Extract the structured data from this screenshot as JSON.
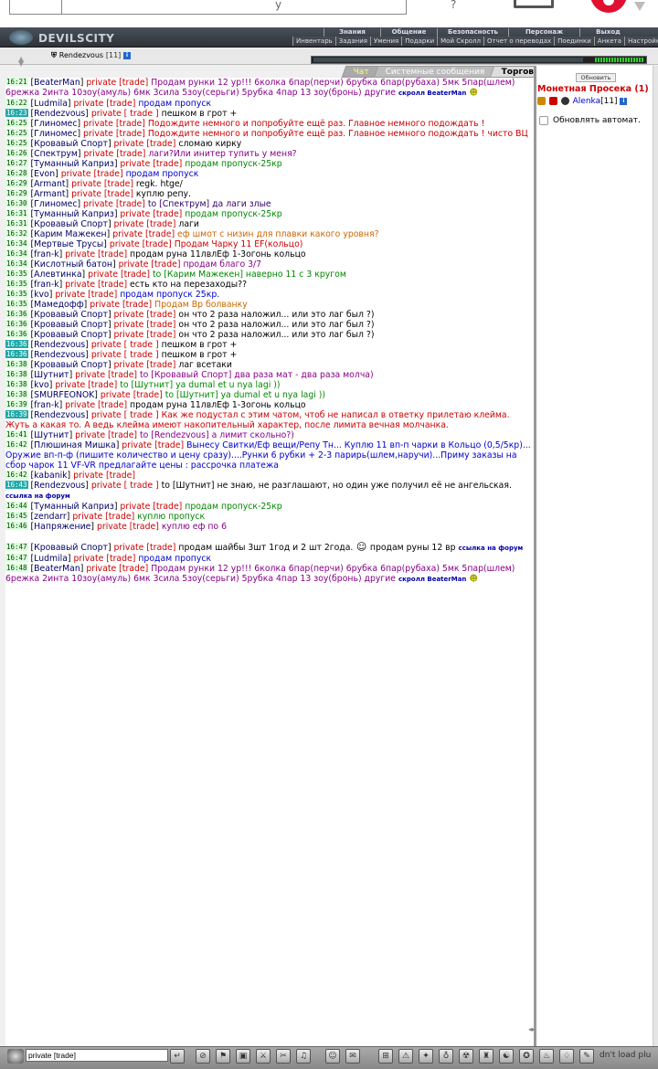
{
  "app": {
    "title": "DEVILSCITY"
  },
  "top_ad": {
    "q_letter": "y",
    "mark": "?"
  },
  "menu_top": [
    "Знания",
    "Общение",
    "Безопасность",
    "Персонаж",
    "Выход"
  ],
  "menu_sub": [
    "Инвентарь",
    "Задания",
    "Умения",
    "Подарки",
    "Мой Скролл",
    "Отчет о переводах",
    "Поединки",
    "Анкета",
    "Настройки"
  ],
  "player": {
    "name": "Rendezvous",
    "level": "[11]"
  },
  "tabs": [
    "Чат",
    "Системные сообщения",
    "Торговля"
  ],
  "chat": [
    {
      "t": "16:21",
      "u": "BeaterMan",
      "m": "private [trade]",
      "tx": "Продам рунки 12 ур!!! 6колка 6пар(перчи) 6рубка 6пар(рубаха) 5мк 5пар(шлем) 6режка 2инта 10зоу(амуль) 6мк 3сила 5зоу(серьги) 5рубка 4пар 13 зоу(бронь) другие",
      "c": "pu",
      "ex": "скролл BeaterMan"
    },
    {
      "t": "16:22",
      "u": "Ludmila",
      "m": "private [trade]",
      "tx": "продам пропуск",
      "c": "bl"
    },
    {
      "t": "16:23",
      "u": "Rendezvous",
      "m": "private [ trade ]",
      "tx": "пешком в грот +",
      "c": "u",
      "me": true
    },
    {
      "t": "16:25",
      "u": "Глиномес",
      "m": "private [trade]",
      "tx": "Подождите немного и попробуйте ещё раз. Главное немного подождать !",
      "c": "rd"
    },
    {
      "t": "16:25",
      "u": "Глиномес",
      "m": "private [trade]",
      "tx": "Подождите немного и попробуйте ещё раз. Главное немного подождать ! чисто ВЦ",
      "c": "rd"
    },
    {
      "t": "16:25",
      "u": "Кровавый Спорт",
      "m": "private [trade]",
      "tx": "сломаю кирку",
      "c": "u"
    },
    {
      "t": "16:26",
      "u": "Спектрум",
      "m": "private [trade]",
      "tx": "лаги?Или инитер тупить у меня?",
      "c": "pu"
    },
    {
      "t": "16:27",
      "u": "Туманный Каприз",
      "m": "private [trade]",
      "tx": "продам пропуск-25кр",
      "c": "g1"
    },
    {
      "t": "16:28",
      "u": "Evon",
      "m": "private [trade]",
      "tx": "продам пропуск",
      "c": "bl"
    },
    {
      "t": "16:29",
      "u": "Armant",
      "m": "private [trade]",
      "tx": "regk. htge/",
      "c": "u"
    },
    {
      "t": "16:29",
      "u": "Armant",
      "m": "private [trade]",
      "tx": "куплю репу.",
      "c": "u"
    },
    {
      "t": "16:30",
      "u": "Глиномес",
      "m": "private [trade]",
      "tx": "to [Спектрум] да лаги злые",
      "c": "bl2"
    },
    {
      "t": "16:31",
      "u": "Туманный Каприз",
      "m": "private [trade]",
      "tx": "продам пропуск-25кр",
      "c": "g1"
    },
    {
      "t": "16:31",
      "u": "Кровавый Спорт",
      "m": "private [trade]",
      "tx": "лаги",
      "c": "u"
    },
    {
      "t": "16:32",
      "u": "Карим Мажекен",
      "m": "private [trade]",
      "tx": "еф шмот с низин для плавки какого уровня?",
      "c": "or"
    },
    {
      "t": "16:34",
      "u": "Мертвые Трусы",
      "m": "private [trade]",
      "tx": "Продам Чарку 11 ЕF(кольцо)",
      "c": "rd"
    },
    {
      "t": "16:34",
      "u": "fran-k",
      "m": "private [trade]",
      "tx": "продам руна 11лвлЕф 1-3огонь кольцо",
      "c": "u"
    },
    {
      "t": "16:34",
      "u": "Кислотный батон",
      "m": "private [trade]",
      "tx": "продам благо 3/7",
      "c": "pu"
    },
    {
      "t": "16:35",
      "u": "Алевтинка",
      "m": "private [trade]",
      "tx": "to [Карим Мажекен] наверно 11 с 3 кругом",
      "c": "g1"
    },
    {
      "t": "16:35",
      "u": "fran-k",
      "m": "private [trade]",
      "tx": "есть кто на перезаходы??",
      "c": "u"
    },
    {
      "t": "16:35",
      "u": "kvo",
      "m": "private [trade]",
      "tx": "продам пропуск 25кр.",
      "c": "bl"
    },
    {
      "t": "16:35",
      "u": "Мамедофф",
      "m": "private [trade]",
      "tx": "Продам Вр болванку",
      "c": "or"
    },
    {
      "t": "16:36",
      "u": "Кровавый Спорт",
      "m": "private [trade]",
      "tx": "он что 2 раза наложил... или это лаг был ?)",
      "c": "u"
    },
    {
      "t": "16:36",
      "u": "Кровавый Спорт",
      "m": "private [trade]",
      "tx": "он что 2 раза наложил... или это лаг был ?)",
      "c": "u"
    },
    {
      "t": "16:36",
      "u": "Кровавый Спорт",
      "m": "private [trade]",
      "tx": "он что 2 раза наложил... или это лаг был ?)",
      "c": "u"
    },
    {
      "t": "16:36",
      "u": "Rendezvous",
      "m": "private [ trade ]",
      "tx": "пешком в грот +",
      "c": "u",
      "me": true
    },
    {
      "t": "16:36",
      "u": "Rendezvous",
      "m": "private [ trade ]",
      "tx": "пешком в грот +",
      "c": "u",
      "me": true
    },
    {
      "t": "16:38",
      "u": "Кровавый Спорт",
      "m": "private [trade]",
      "tx": "лаг всетаки",
      "c": "u"
    },
    {
      "t": "16:38",
      "u": "Шутнит",
      "m": "private [trade]",
      "tx": "to [Кровавый Спорт] два раза мат - два раза молча)",
      "c": "pu"
    },
    {
      "t": "16:38",
      "u": "kvo",
      "m": "private [trade]",
      "tx": "to [Шутнит] ya dumal et u nya lagi ))",
      "c": "g1"
    },
    {
      "t": "16:38",
      "u": "SMURFEONOK",
      "m": "private [trade]",
      "tx": "to [Шутнит] ya dumal et u nya lagi ))",
      "c": "g1"
    },
    {
      "t": "16:39",
      "u": "fran-k",
      "m": "private [trade]",
      "tx": "продам руна 11лвлЕф 1-3огонь кольцо",
      "c": "u"
    },
    {
      "t": "16:39",
      "u": "Rendezvous",
      "m": "private [ trade ]",
      "tx": "Как же подустал с этим чатом, чтоб не написал в ответку прилетаю клейма. Жуть а какая то. А ведь клейма имеют накопительный характер, после лимита вечная молчанка.",
      "c": "rd",
      "me": true
    },
    {
      "t": "16:41",
      "u": "Шутнит",
      "m": "private [trade]",
      "tx": "to [Rendezvous] а лимит скольно?)",
      "c": "pu"
    },
    {
      "t": "16:42",
      "u": "Плюшиная Мишка",
      "m": "private [trade]",
      "tx": "Вынесу Свитки/Еф вещи/Репу Тн... Куплю 11 вп-п чарки в Кольцо (0,5/5кр)... Оружие вп-п-ф (пишите количество и цену сразу)....Рунки 6 рубки + 2-3 парирь(шлем,наручи)...Приму заказы на сбор чарок 11 VF-VR предлагайте цены : рассрочка платежа",
      "c": "bl"
    },
    {
      "t": "16:42",
      "u": "kabanik",
      "m": "private [trade]",
      "tx": "",
      "c": "u"
    },
    {
      "t": "16:43",
      "u": "Rendezvous",
      "m": "private [ trade ]",
      "tx": "to [Шутнит] не знаю, не разглашают, но один уже получил её не ангельская.",
      "c": "u",
      "me": true,
      "ex": "ссылка на форум"
    },
    {
      "t": "16:44",
      "u": "Туманный Каприз",
      "m": "private [trade]",
      "tx": "продам пропуск-25кр",
      "c": "g1"
    },
    {
      "t": "16:45",
      "u": "zendarr",
      "m": "private [trade]",
      "tx": "куплю пропуск",
      "c": "g1"
    },
    {
      "t": "16:46",
      "u": "Напряжение",
      "m": "private [trade]",
      "tx": "куплю еф по 6",
      "c": "pu"
    },
    {
      "t": "16:47",
      "u": "Кровавый Спорт",
      "m": "private [trade]",
      "tx": "продам шайбы 3шт 1год и 2 шт 2года.",
      "tx2": "продам руны 12 вр",
      "c": "u",
      "ex": "ссылка на форум",
      "big": true
    },
    {
      "t": "16:47",
      "u": "Ludmila",
      "m": "private [trade]",
      "tx": "продам пропуск",
      "c": "bl"
    },
    {
      "t": "16:48",
      "u": "BeaterMan",
      "m": "private [trade]",
      "tx": "Продам рунки 12 ур!!! 6колка 6пар(перчи) 6рубка 6пар(рубаха) 5мк 5пар(шлем) 6режка 2инта 10зоу(амуль) 6мк 3сила 5зоу(серьги) 5рубка 4пар 13 зоу(бронь) другие",
      "c": "pu",
      "ex": "скролл BeaterMan"
    }
  ],
  "right": {
    "update_btn": "Обновить",
    "room": "Монетная Просека (1)",
    "online_user": "Alenka",
    "online_level": "[11]",
    "auto_label": "Обновлять автомат."
  },
  "bottom": {
    "input_value": "private [trade]",
    "end_text": "dn't load plu"
  },
  "colors": {
    "accent": "#c00",
    "time_bg": "#dfd",
    "panel_bar": "#3a4048"
  }
}
